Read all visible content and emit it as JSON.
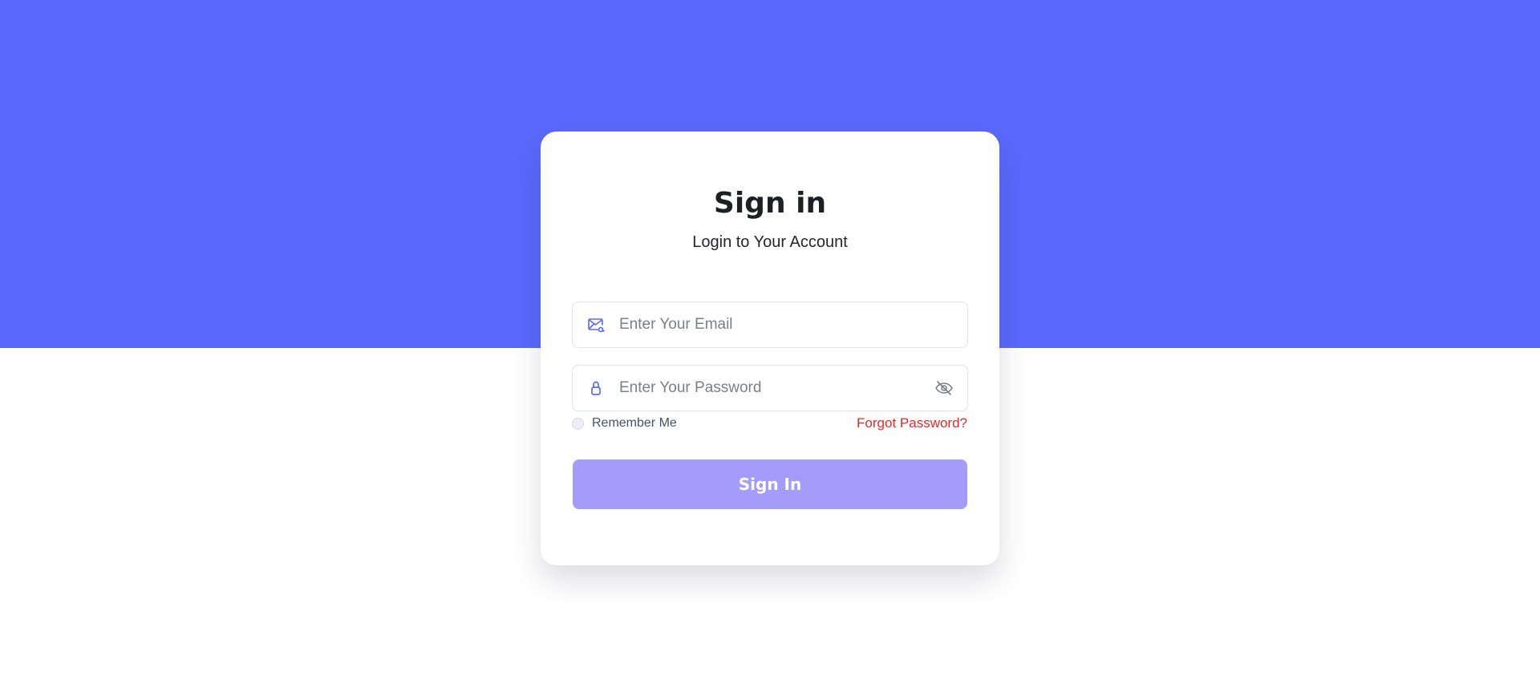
{
  "colors": {
    "hero_background": "#5a69fd",
    "button_background": "#a49cfb",
    "forgot_link": "#e82727",
    "icon_accent": "#5a69fd"
  },
  "signin": {
    "title": "Sign in",
    "subtitle": "Login to Your Account",
    "email": {
      "placeholder": "Enter Your Email",
      "value": "",
      "icon": "email-icon"
    },
    "password": {
      "placeholder": "Enter Your Password",
      "value": "",
      "icon": "lock-icon",
      "toggle_icon": "eye-off-icon"
    },
    "remember_label": "Remember Me",
    "remember_checked": false,
    "forgot_label": "Forgot Password?",
    "button_label": "Sign In"
  }
}
